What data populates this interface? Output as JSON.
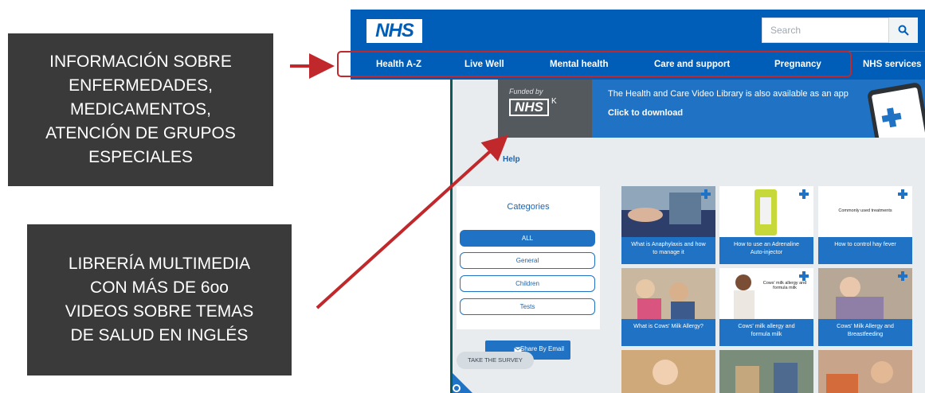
{
  "callouts": {
    "top_text": "INFORMACIÓN SOBRE\nENFERMEDADES,\nMEDICAMENTOS,\nATENCIÓN DE GRUPOS\nESPECIALES",
    "bottom_text": "LIBRERÍA MULTIMEDIA\nCON MÁS DE 6oo\nVIDEOS SOBRE TEMAS\nDE SALUD EN INGLÉS"
  },
  "nhs_site": {
    "logo": "NHS",
    "search_placeholder": "Search",
    "nav": [
      "Health A-Z",
      "Live Well",
      "Mental health",
      "Care and support",
      "Pregnancy",
      "NHS services"
    ]
  },
  "video_library": {
    "banner": {
      "funded_by": "Funded by",
      "logo": "NHS",
      "logo_suffix": "K",
      "message": "The Health and Care Video Library is also available as an app",
      "cta": "Click to download"
    },
    "help_link": "Help",
    "categories_title": "Categories",
    "categories": [
      "ALL",
      "General",
      "Children",
      "Tests"
    ],
    "email_button": "Share By Email",
    "survey_button": "TAKE THE SURVEY",
    "videos": [
      "What is Anaphylaxis and how\nto manage it",
      "How to use an Adrenaline\nAuto-injector",
      "How to control hay fever",
      "What is Cows' Milk Allergy?",
      "Cows' milk allergy and\nformula milk",
      "Cows' Milk Allergy and\nBreastfeeding"
    ],
    "thumb_texts": [
      "Commonly used treatments",
      "Cows' milk allergy and formula milk"
    ]
  },
  "colors": {
    "nhs_blue": "#005eb8",
    "callout_bg": "#3a3a3a",
    "arrow_red": "#c0282c",
    "library_blue": "#1f72c4"
  },
  "icons": [
    "search-icon",
    "share-email-icon",
    "settings-gear-icon",
    "nhs-cross-icon"
  ]
}
